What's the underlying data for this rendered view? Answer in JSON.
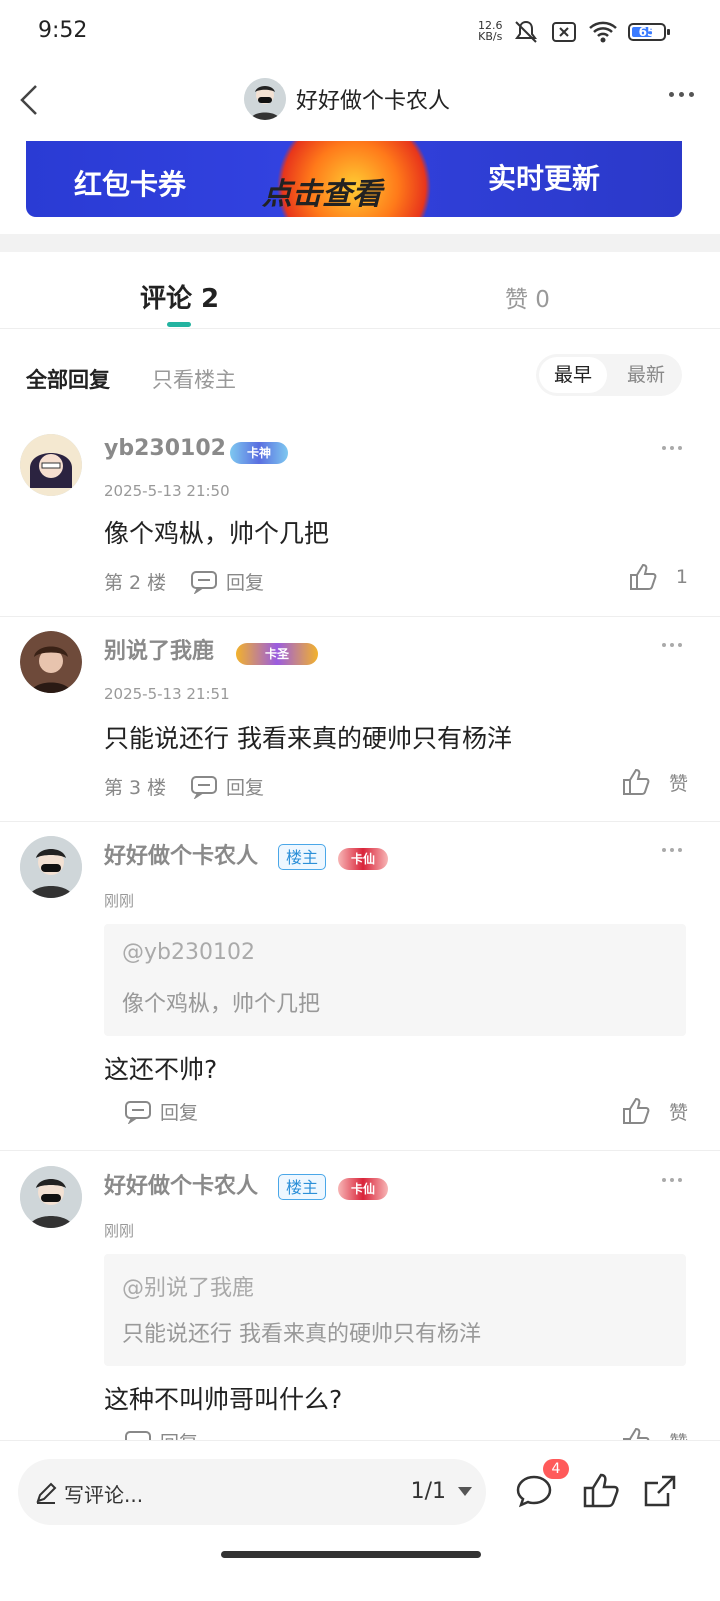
{
  "status": {
    "time": "9:52",
    "net_speed": "12.6",
    "net_unit": "KB/s",
    "battery": "65"
  },
  "nav": {
    "title": "好好做个卡农人"
  },
  "banner": {
    "left_text": "红包卡券",
    "center_text": "点击查看",
    "right_text": "实时更新"
  },
  "tabs": {
    "comments": "评论 2",
    "likes": "赞 0"
  },
  "filters": {
    "all": "全部回复",
    "op_only": "只看楼主",
    "earliest": "最早",
    "latest": "最新"
  },
  "comments": [
    {
      "name": "yb230102",
      "badge": "卡神",
      "time": "2025-5-13 21:50",
      "text": "像个鸡枞，帅个几把",
      "floor": "第 2 楼",
      "reply": "回复",
      "like": "1"
    },
    {
      "name": "别说了我鹿",
      "badge": "卡圣",
      "time": "2025-5-13 21:51",
      "text": "只能说还行 我看来真的硬帅只有杨洋",
      "floor": "第 3 楼",
      "reply": "回复",
      "like": "赞"
    },
    {
      "name": "好好做个卡农人",
      "op_tag": "楼主",
      "badge": "卡仙",
      "time": "刚刚",
      "quote_user": "@yb230102",
      "quote_text": "像个鸡枞，帅个几把",
      "text": "这还不帅?",
      "reply": "回复",
      "like": "赞"
    },
    {
      "name": "好好做个卡农人",
      "op_tag": "楼主",
      "badge": "卡仙",
      "time": "刚刚",
      "quote_user": "@别说了我鹿",
      "quote_text": "只能说还行 我看来真的硬帅只有杨洋",
      "text": "这种不叫帅哥叫什么?",
      "reply": "回复",
      "like": "赞"
    }
  ],
  "bottom": {
    "placeholder": "写评论...",
    "page": "1/1",
    "comment_count": "4"
  }
}
